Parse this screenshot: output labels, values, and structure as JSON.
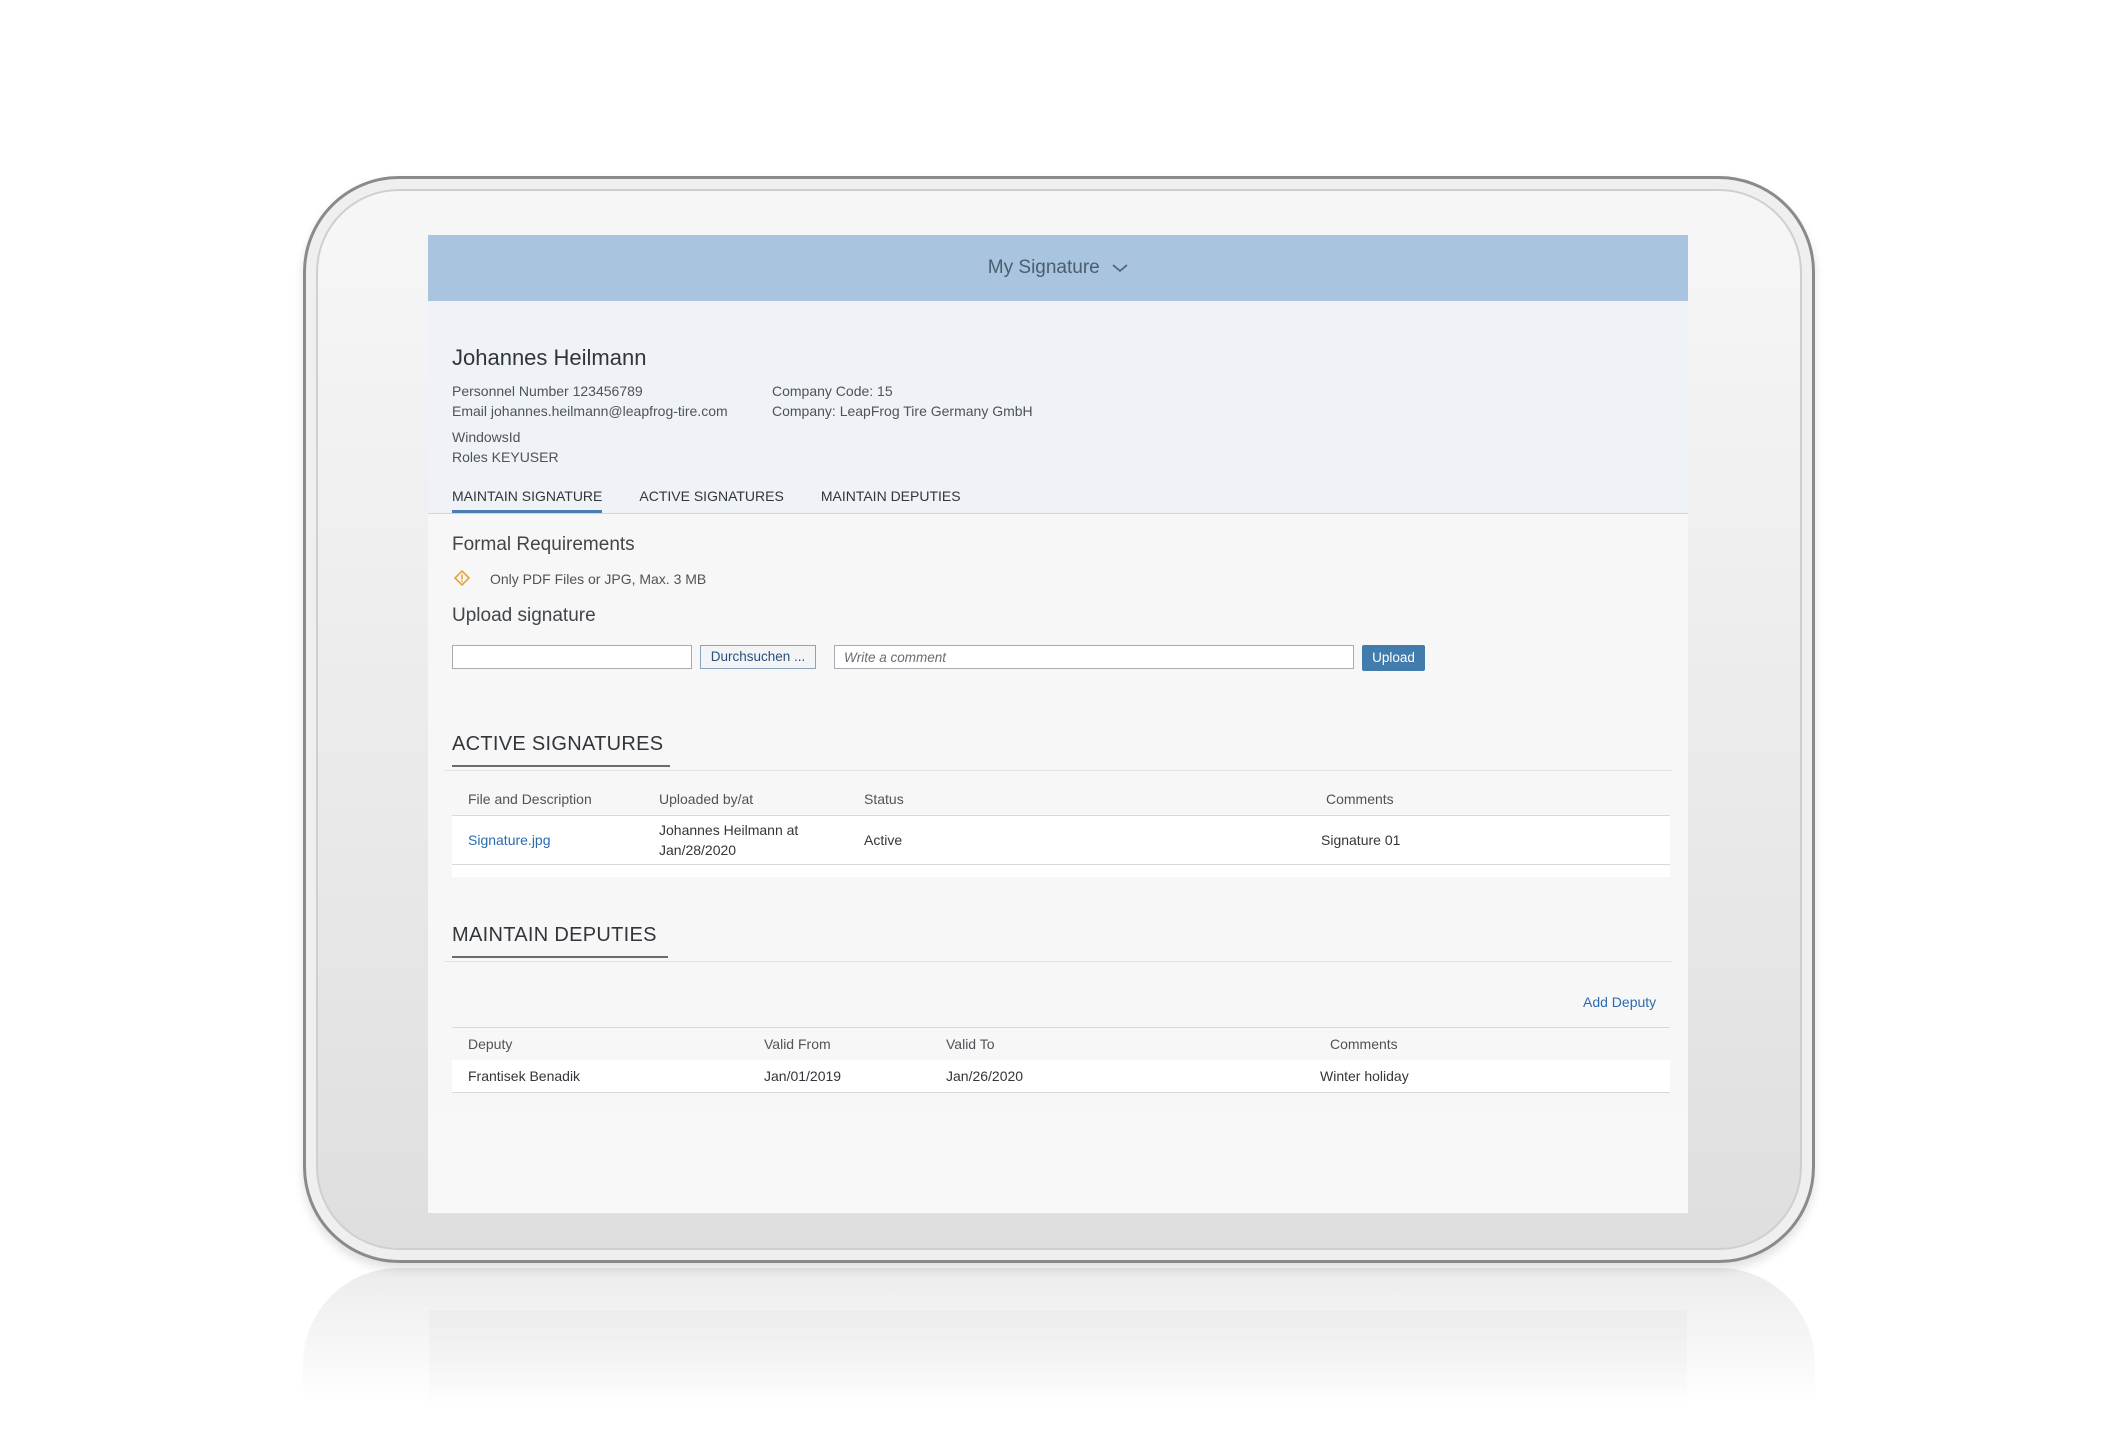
{
  "shell": {
    "title": "My Signature"
  },
  "user": {
    "name": "Johannes Heilmann",
    "personnel_number": "Personnel Number 123456789",
    "email": "Email johannes.heilmann@leapfrog-tire.com",
    "windows_id": "WindowsId",
    "roles": "Roles KEYUSER",
    "company_code": "Company Code: 15",
    "company": "Company: LeapFrog Tire Germany GmbH"
  },
  "tabs": [
    {
      "label": "MAINTAIN SIGNATURE",
      "active": true
    },
    {
      "label": "ACTIVE SIGNATURES",
      "active": false
    },
    {
      "label": "MAINTAIN DEPUTIES",
      "active": false
    }
  ],
  "formal": {
    "title": "Formal Requirements",
    "note": "Only PDF Files or JPG, Max. 3 MB"
  },
  "upload": {
    "title": "Upload signature",
    "file_value": "",
    "browse_label": "Durchsuchen ...",
    "comment_placeholder": "Write a comment",
    "upload_label": "Upload"
  },
  "active_signatures": {
    "title": "ACTIVE SIGNATURES",
    "columns": [
      "File and Description",
      "Uploaded by/at",
      "Status",
      "Comments"
    ],
    "rows": [
      {
        "file": "Signature.jpg",
        "uploaded_line1": "Johannes Heilmann at",
        "uploaded_line2": "Jan/28/2020",
        "status": "Active",
        "comments": "Signature 01"
      }
    ]
  },
  "deputies": {
    "title": "MAINTAIN DEPUTIES",
    "add_label": "Add Deputy",
    "columns": [
      "Deputy",
      "Valid From",
      "Valid To",
      "Comments"
    ],
    "rows": [
      {
        "deputy": "Frantisek Benadik",
        "valid_from": "Jan/01/2019",
        "valid_to": "Jan/26/2020",
        "comments": "Winter holiday"
      }
    ]
  },
  "colors": {
    "shellbar": "#a9c4de",
    "accent": "#427cac",
    "link": "#2b6bb0",
    "warning": "#e9a53a"
  }
}
